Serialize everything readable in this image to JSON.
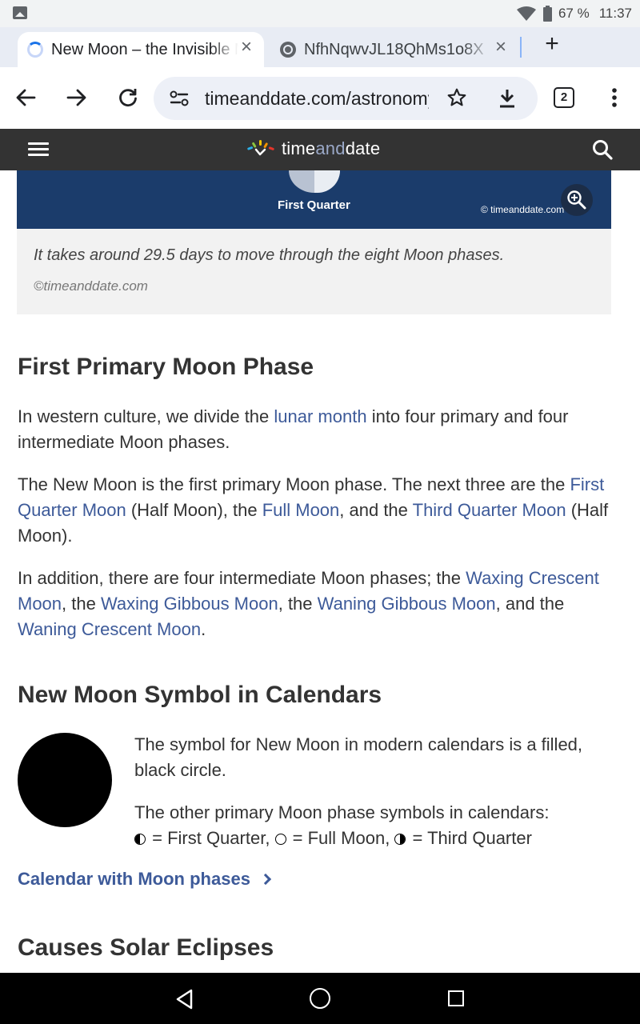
{
  "status_bar": {
    "battery": "67 %",
    "time": "11:37"
  },
  "tabs": [
    {
      "title": "New Moon – the Invisible Moon",
      "active": true
    },
    {
      "title": "NfhNqwvJL18QhMs1o8X",
      "active": false
    }
  ],
  "toolbar": {
    "url": "timeanddate.com/astronomy/moon/new-moon.html",
    "tab_count": "2"
  },
  "site": {
    "logo_time": "time",
    "logo_and": "and",
    "logo_date": "date"
  },
  "image": {
    "label": "First Quarter",
    "copyright": "© timeanddate.com",
    "caption": "It takes around 29.5 days to move through the eight Moon phases.",
    "credit": "©timeanddate.com"
  },
  "section1": {
    "heading": "First Primary Moon Phase",
    "p1_pre": "In western culture, we divide the ",
    "p1_link": "lunar month",
    "p1_post": " into four primary and four intermediate Moon phases.",
    "p2_a": "The New Moon is the first primary Moon phase. The next three are the ",
    "p2_link1": "First Quarter Moon",
    "p2_b": " (Half Moon), the ",
    "p2_link2": "Full Moon",
    "p2_c": ", and the ",
    "p2_link3": "Third Quarter Moon",
    "p2_d": " (Half Moon).",
    "p3_a": "In addition, there are four intermediate Moon phases; the ",
    "p3_link1": "Waxing Crescent Moon",
    "p3_b": ", the ",
    "p3_link2": "Waxing Gibbous Moon",
    "p3_c": ", the ",
    "p3_link3": "Waning Gibbous Moon",
    "p3_d": ", and the ",
    "p3_link4": "Waning Crescent Moon",
    "p3_e": "."
  },
  "section2": {
    "heading": "New Moon Symbol in Calendars",
    "p1": "The symbol for New Moon in modern calendars is a filled, black circle.",
    "p2_a": "The other primary Moon phase symbols in calendars:",
    "p2_fq": " = First Quarter, ",
    "p2_fm": " = Full Moon, ",
    "p2_tq": " = Third Quarter",
    "link": "Calendar with Moon phases"
  },
  "section3": {
    "heading": "Causes Solar Eclipses"
  }
}
